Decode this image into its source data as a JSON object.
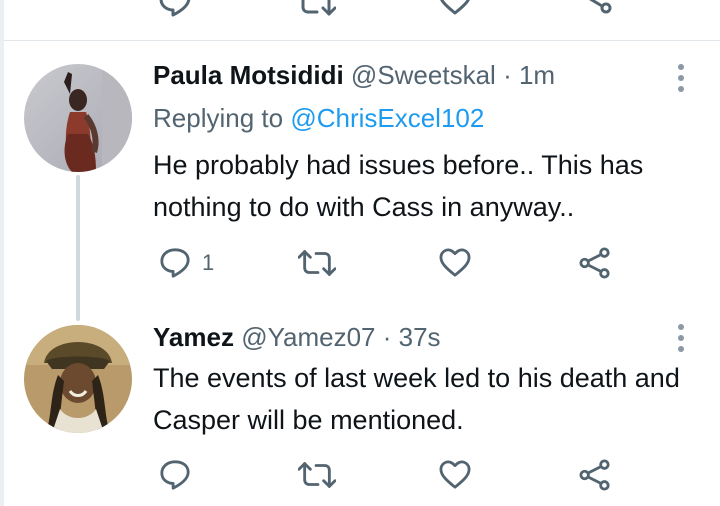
{
  "tweets": [
    {
      "name": "Paula Motsididi",
      "handle": "@Sweetskal",
      "separator": "·",
      "time": "1m",
      "replying_prefix": "Replying to",
      "replying_to": "@ChrisExcel102",
      "text": "He probably had issues before.. This has nothing to do with Cass in anyway..",
      "reply_count": "1"
    },
    {
      "name": "Yamez",
      "handle": "@Yamez07",
      "separator": "·",
      "time": "37s",
      "text": "The events of last week led to his death and Casper will be mentioned."
    }
  ],
  "colors": {
    "link": "#1d9bf0",
    "secondary_text": "#536471",
    "icon": "#536471",
    "divider": "#e1e6ea"
  },
  "icons": [
    "reply-icon",
    "retweet-icon",
    "like-icon",
    "share-icon",
    "more-icon"
  ]
}
